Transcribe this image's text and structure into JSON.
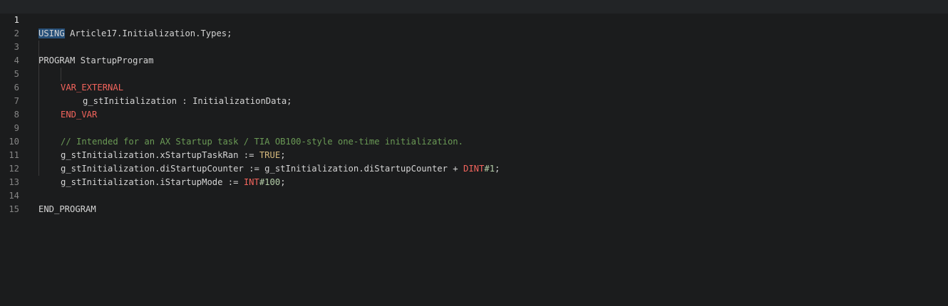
{
  "editor": {
    "line_numbers": [
      "1",
      "2",
      "3",
      "4",
      "5",
      "6",
      "7",
      "8",
      "9",
      "10",
      "11",
      "12",
      "13",
      "14",
      "15"
    ],
    "lines": {
      "l1": {
        "kw": "USING",
        "rest": " Article17.Initialization.Types;"
      },
      "l3": {
        "text": "PROGRAM StartupProgram"
      },
      "l5": {
        "kw": "VAR_EXTERNAL"
      },
      "l6": {
        "text": "g_stInitialization : InitializationData;"
      },
      "l7": {
        "kw": "END_VAR"
      },
      "l9": {
        "comment": "// Intended for an AX Startup task / TIA OB100-style one-time initialization."
      },
      "l10": {
        "pre": "g_stInitialization.xStartupTaskRan := ",
        "lit": "TRUE",
        "post": ";"
      },
      "l11": {
        "pre": "g_stInitialization.diStartupCounter := g_stInitialization.diStartupCounter + ",
        "type": "DINT",
        "num": "#1",
        "post": ";"
      },
      "l12": {
        "pre": "g_stInitialization.iStartupMode := ",
        "type": "INT",
        "num": "#100",
        "post": ";"
      },
      "l14": {
        "text": "END_PROGRAM"
      }
    }
  },
  "colors": {
    "background": "#1b1c1d",
    "keyword": "#f2645c",
    "comment": "#6a9955",
    "number": "#b5cea8",
    "selection": "#264f78"
  }
}
